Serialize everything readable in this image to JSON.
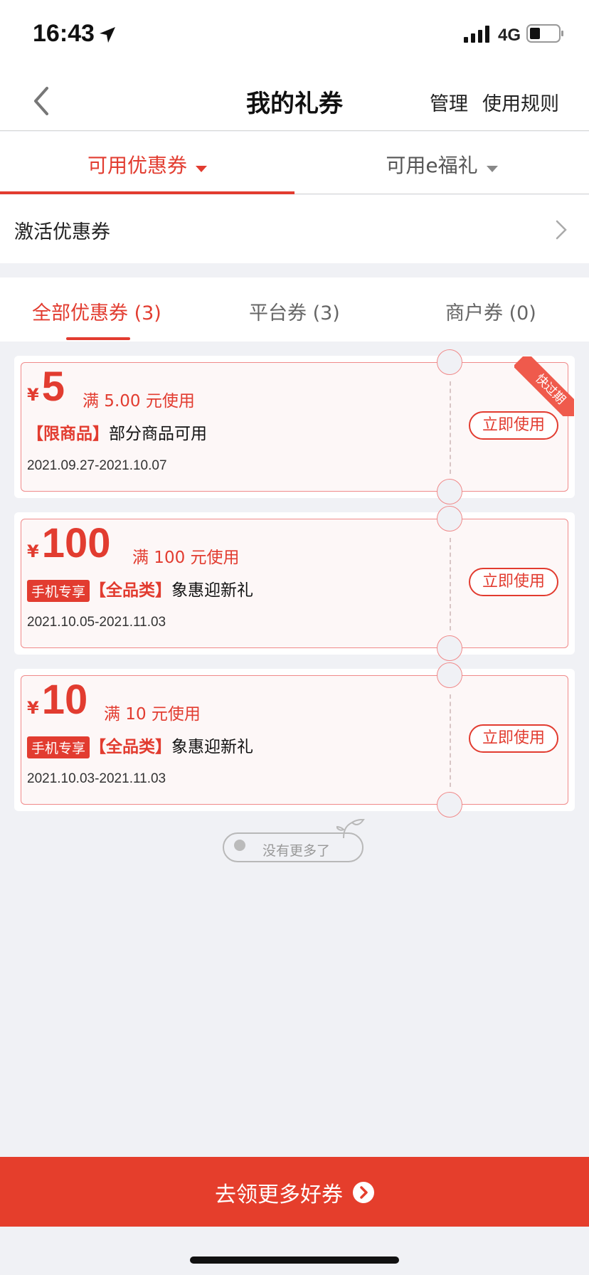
{
  "status_bar": {
    "time": "16:43",
    "network": "4G"
  },
  "nav": {
    "title": "我的礼券",
    "manage": "管理",
    "rules": "使用规则"
  },
  "top_tabs": [
    {
      "label": "可用优惠券",
      "active": true
    },
    {
      "label": "可用e福礼",
      "active": false
    }
  ],
  "activate": {
    "label": "激活优惠券"
  },
  "sub_tabs": [
    {
      "label": "全部优惠券 (3)",
      "active": true
    },
    {
      "label": "平台券 (3)",
      "active": false
    },
    {
      "label": "商户券 (0)",
      "active": false
    }
  ],
  "coupons": [
    {
      "currency": "¥",
      "amount": "5",
      "condition": "满 5.00 元使用",
      "badge": "",
      "tag": "【限商品】",
      "name": "部分商品可用",
      "dates": "2021.09.27-2021.10.07",
      "button": "立即使用",
      "ribbon": "快过期"
    },
    {
      "currency": "¥",
      "amount": "100",
      "condition": "满 100 元使用",
      "badge": "手机专享",
      "tag": "【全品类】",
      "name": "象惠迎新礼",
      "dates": "2021.10.05-2021.11.03",
      "button": "立即使用",
      "ribbon": ""
    },
    {
      "currency": "¥",
      "amount": "10",
      "condition": "满 10 元使用",
      "badge": "手机专享",
      "tag": "【全品类】",
      "name": "象惠迎新礼",
      "dates": "2021.10.03-2021.11.03",
      "button": "立即使用",
      "ribbon": ""
    }
  ],
  "no_more": "没有更多了",
  "bottom_button": "去领更多好券",
  "colors": {
    "accent": "#e23c30",
    "bottom": "#e53e2c",
    "background": "#f0f1f5"
  }
}
